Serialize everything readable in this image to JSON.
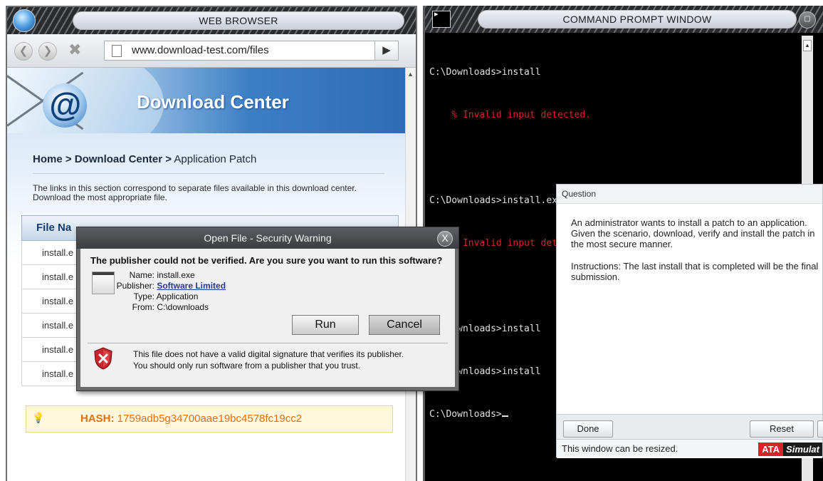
{
  "browser": {
    "title": "WEB BROWSER",
    "url": "www.download-test.com/files",
    "go_icon": "arrow-right-icon",
    "banner_title": "Download Center",
    "breadcrumb_bold": "Home > Download Center >",
    "breadcrumb_rest": " Application Patch",
    "description": "The links in this section correspond to separate files available in this download center. Download the most appropriate file.",
    "table_header": "File Na",
    "rows": [
      "install.e",
      "install.e",
      "install.e",
      "install.e",
      "install.e",
      "install.e"
    ],
    "hash_label": "HASH:",
    "hash_value": " 1759adb5g34700aae19bc4578fc19cc2"
  },
  "security_dialog": {
    "title": "Open File - Security Warning",
    "close_label": "X",
    "question": "The publisher could not be verified. Are you sure you want to run this software?",
    "name_label": "Name:",
    "name_value": "install.exe",
    "publisher_label": "Publisher:",
    "publisher_value": "Software Limited",
    "type_label": "Type:",
    "type_value": "Application",
    "from_label": "From:",
    "from_value": "C:\\downloads",
    "run_label": "Run",
    "cancel_label": "Cancel",
    "warning_line1": "This file does not have a valid digital signature that verifies its publisher.",
    "warning_line2": "You should only run software from a publisher that you trust."
  },
  "cmd": {
    "title": "COMMAND PROMPT WINDOW",
    "lines": [
      {
        "text": "C:\\Downloads>install",
        "type": "cmd"
      },
      {
        "text": "    % Invalid input detected.",
        "type": "err"
      },
      {
        "text": "",
        "type": "blank"
      },
      {
        "text": "C:\\Downloads>install.exe",
        "type": "cmd"
      },
      {
        "text": "    % Invalid input detected.",
        "type": "err"
      },
      {
        "text": "",
        "type": "blank"
      },
      {
        "text": "C:\\Downloads>install",
        "type": "cmd"
      },
      {
        "text": "C:\\Downloads>install",
        "type": "cmd"
      }
    ],
    "prompt": "C:\\Downloads>"
  },
  "question": {
    "header": "Question",
    "paragraph1": "An administrator wants to install a patch to an application. Given the scenario, download, verify and install the patch in the most secure manner.",
    "paragraph2": "Instructions: The last install that is completed will be the final submission.",
    "done_label": "Done",
    "reset_label": "Reset",
    "status": "This window can be resized.",
    "brand_a": "ATA",
    "brand_b": "Simulat"
  },
  "colors": {
    "error_text": "#d12727",
    "hash_text": "#e07010",
    "link": "#1f3d8a",
    "brand_red": "#d8232a"
  }
}
